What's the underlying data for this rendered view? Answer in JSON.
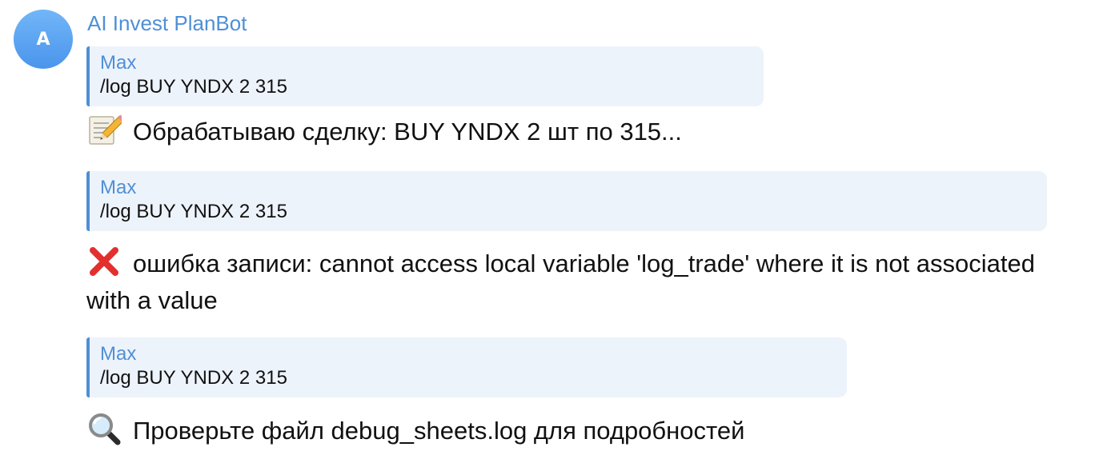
{
  "sender": {
    "name": "AI Invest PlanBot",
    "avatar_letter": "A"
  },
  "messages": [
    {
      "reply": {
        "author": "Max",
        "text": "/log BUY YNDX 2 315"
      },
      "icon": "memo-icon",
      "text": "Обрабатываю сделку: BUY YNDX 2 шт по 315..."
    },
    {
      "reply": {
        "author": "Max",
        "text": "/log BUY YNDX 2 315"
      },
      "icon": "cross-mark-icon",
      "text": "ошибка записи: cannot access local variable 'log_trade' where it is not associated with a value"
    },
    {
      "reply": {
        "author": "Max",
        "text": "/log BUY YNDX 2 315"
      },
      "icon": "magnifier-icon",
      "text": "Проверьте файл debug_sheets.log для подробностей"
    }
  ],
  "colors": {
    "accent": "#4f8fd6",
    "reply_background": "#edf3fb",
    "text": "#111111",
    "error": "#e2302f"
  }
}
